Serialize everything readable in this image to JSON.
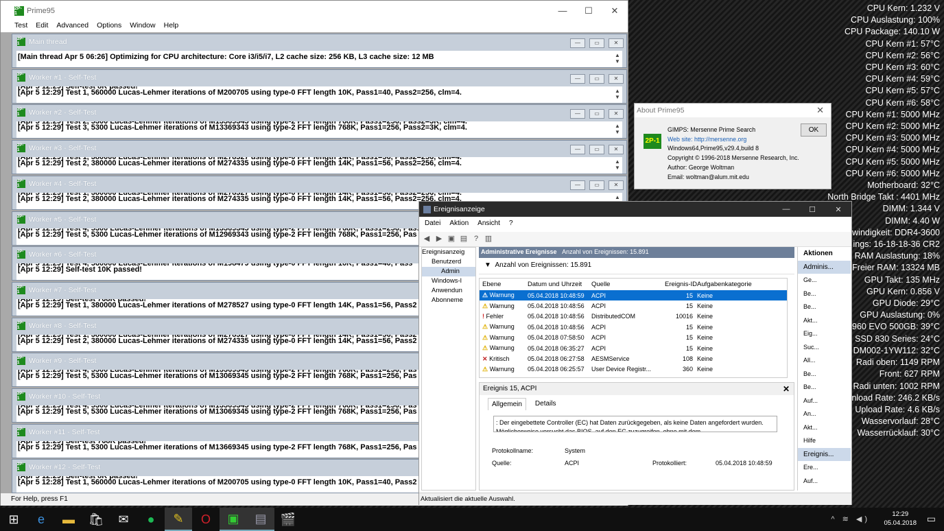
{
  "overlay": [
    "CPU Kern: 1.232 V",
    "CPU Auslastung: 100%",
    "CPU Package: 140.10 W",
    "CPU Kern #1: 57°C",
    "CPU Kern #2: 56°C",
    "CPU Kern #3: 60°C",
    "CPU Kern #4: 59°C",
    "CPU Kern #5: 57°C",
    "CPU Kern #6: 58°C",
    "CPU Kern #1: 5000 MHz",
    "CPU Kern #2: 5000 MHz",
    "CPU Kern #3: 5000 MHz",
    "CPU Kern #4: 5000 MHz",
    "CPU Kern #5: 5000 MHz",
    "CPU Kern #6: 5000 MHz",
    "Motherboard: 32°C",
    "North Bridge Takt : 4401 MHz",
    "DIMM: 1.344 V",
    "DIMM: 4.40 W",
    "windigkeit: DDR4-3600",
    "ings: 16-18-18-36 CR2",
    "RAM Auslastung: 18%",
    "Freier RAM: 13324 MB",
    "GPU Takt: 135 MHz",
    "GPU Kern: 0.856 V",
    "GPU Diode: 29°C",
    "GPU Auslastung: 0%",
    "960 EVO 500GB: 39°C",
    "G SSD 830 Series: 24°C",
    "DM002-1YW112: 32°C",
    "Radi oben: 1149 RPM",
    "Front: 627 RPM",
    "Radi unten: 1002 RPM",
    "nload Rate: 246.2 KB/s",
    "Upload Rate: 4.6 KB/s",
    "Wasservorlauf: 28°C",
    "Wasserrücklauf: 30°C"
  ],
  "prime95": {
    "title": "Prime95",
    "icon_text": "2P-1",
    "menu": [
      "Test",
      "Edit",
      "Advanced",
      "Options",
      "Window",
      "Help"
    ],
    "status": "For Help, press F1",
    "threads": [
      {
        "title": "Main thread",
        "l1": "",
        "l2": "[Main thread Apr 5 06:26] Optimizing for CPU architecture: Core i3/i5/i7, L2 cache size: 256 KB, L3 cache size: 12 MB"
      },
      {
        "title": "Worker #1 - Self-Test",
        "l1": "[Apr 5 12:29] Self-test 8K passed!",
        "l2": "[Apr 5 12:29] Test 1, 560000 Lucas-Lehmer iterations of M200705 using type-0 FFT length 10K, Pass1=40, Pass2=256, clm=4."
      },
      {
        "title": "Worker #2 - Self-Test",
        "l1": "[Apr 5 12:29] Test 2, 5300 Lucas-Lehmer iterations of M13369345 using type-2 FFT length 768K, Pass1=256, Pass2=3K, clm=4.",
        "l2": "[Apr 5 12:29] Test 3, 5300 Lucas-Lehmer iterations of M13369343 using type-2 FFT length 768K, Pass1=256, Pass2=3K, clm=4."
      },
      {
        "title": "Worker #3 - Self-Test",
        "l1": "[Apr 5 12:29] Test 1, 380000 Lucas-Lehmer iterations of M278527 using type-0 FFT length 14K, Pass1=56, Pass2=256, clm=4.",
        "l2": "[Apr 5 12:29] Test 2, 380000 Lucas-Lehmer iterations of M274335 using type-0 FFT length 14K, Pass1=56, Pass2=256, clm=4."
      },
      {
        "title": "Worker #4 - Self-Test",
        "l1": "[Apr 5 12:29] Test 1, 380000 Lucas-Lehmer iterations of M278527 using type-0 FFT length 14K, Pass1=56, Pass2=256, clm=4.",
        "l2": "[Apr 5 12:29] Test 2, 380000 Lucas-Lehmer iterations of M274335 using type-0 FFT length 14K, Pass1=56, Pass2=256, clm=4."
      },
      {
        "title": "Worker #5 - Self-Test",
        "l1": "[Apr 5 12:29] Test 4, 5300 Lucas-Lehmer iterations of M13369345 using type-2 FFT length 768K, Pass1=256, Pass2=3K",
        "l2": "[Apr 5 12:29] Test 5, 5300 Lucas-Lehmer iterations of M12969343 using type-2 FFT length 768K, Pass1=256, Pas"
      },
      {
        "title": "Worker #6 - Self-Test",
        "l1": "[Apr 5 12:29] Test 4, 560000 Lucas-Lehmer iterations of M198479 using type-0 FFT length 10K, Pass1=40, Pass",
        "l2": "[Apr 5 12:29] Self-test 10K passed!"
      },
      {
        "title": "Worker #7 - Self-Test",
        "l1": "[Apr 5 12:29] Self-test 768K passed!",
        "l2": "[Apr 5 12:29] Test 1, 380000 Lucas-Lehmer iterations of M278527 using type-0 FFT length 14K, Pass1=56, Pass2"
      },
      {
        "title": "Worker #8 - Self-Test",
        "l1": "[Apr 5 12:29] Test 1, 380000 Lucas-Lehmer iterations of M278527 using type-0 FFT length 14K, Pass1=56, Pass2",
        "l2": "[Apr 5 12:29] Test 2, 380000 Lucas-Lehmer iterations of M274335 using type-0 FFT length 14K, Pass1=56, Pass2"
      },
      {
        "title": "Worker #9 - Self-Test",
        "l1": "[Apr 5 12:29] Test 4, 5300 Lucas-Lehmer iterations of M13369345 using type-2 FFT length 768K, Pass1=256, Pas",
        "l2": "[Apr 5 12:29] Test 5, 5300 Lucas-Lehmer iterations of M13069345 using type-2 FFT length 768K, Pass1=256, Pas"
      },
      {
        "title": "Worker #10 - Self-Test",
        "l1": "[Apr 5 12:29] Test 4, 5300 Lucas-Lehmer iterations of M13369345 using type-2 FFT length 768K, Pass1=256, Pas",
        "l2": "[Apr 5 12:29] Test 5, 5300 Lucas-Lehmer iterations of M13069345 using type-2 FFT length 768K, Pass1=256, Pas"
      },
      {
        "title": "Worker #11 - Self-Test",
        "l1": "[Apr 5 12:29] Self-test 768K passed!",
        "l2": "[Apr 5 12:29] Test 1, 5300 Lucas-Lehmer iterations of M13669345 using type-2 FFT length 768K, Pass1=256, Pas"
      },
      {
        "title": "Worker #12 - Self-Test",
        "l1": "[Apr 5 12:29] Self-test 8K passed!",
        "l2": "[Apr 5 12:28] Test 1, 560000 Lucas-Lehmer iterations of M200705 using type-0 FFT length 10K, Pass1=40, Pass2"
      }
    ]
  },
  "about": {
    "title": "About Prime95",
    "ok": "OK",
    "lines": [
      "GIMPS: Mersenne Prime Search",
      "Web site: http://mersenne.org",
      "Windows64,Prime95,v29.4,build 8",
      "Copyright © 1996-2018 Mersenne Research, Inc.",
      "Author: George Woltman",
      "Email:  woltman@alum.mit.edu"
    ]
  },
  "eventviewer": {
    "title": "Ereignisanzeige",
    "menu": [
      "Datei",
      "Aktion",
      "Ansicht",
      "?"
    ],
    "tree": [
      "Ereignisanzeig",
      "Benutzerd",
      "Admin",
      "Windows-l",
      "Anwendun",
      "Abonneme"
    ],
    "header": "Administrative Ereignisse",
    "header_count": "Anzahl von Ereignissen: 15.891",
    "filter": "Anzahl von Ereignissen: 15.891",
    "columns": [
      "Ebene",
      "Datum und Uhrzeit",
      "Quelle",
      "Ereignis-ID",
      "Aufgabenkategorie"
    ],
    "rows": [
      [
        "Warnung",
        "05.04.2018 10:48:59",
        "ACPI",
        "15",
        "Keine"
      ],
      [
        "Warnung",
        "05.04.2018 10:48:56",
        "ACPI",
        "15",
        "Keine"
      ],
      [
        "Fehler",
        "05.04.2018 10:48:56",
        "DistributedCOM",
        "10016",
        "Keine"
      ],
      [
        "Warnung",
        "05.04.2018 10:48:56",
        "ACPI",
        "15",
        "Keine"
      ],
      [
        "Warnung",
        "05.04.2018 07:58:50",
        "ACPI",
        "15",
        "Keine"
      ],
      [
        "Warnung",
        "05.04.2018 06:35:27",
        "ACPI",
        "15",
        "Keine"
      ],
      [
        "Kritisch",
        "05.04.2018 06:27:58",
        "AESMService",
        "108",
        "Keine"
      ],
      [
        "Warnung",
        "05.04.2018 06:25:57",
        "User Device Registr...",
        "360",
        "Keine"
      ]
    ],
    "detail_title": "Ereignis 15, ACPI",
    "tabs": [
      "Allgemein",
      "Details"
    ],
    "detail_text": ": Der eingebettete Controller (EC) hat Daten zurückgegeben, als keine Daten angefordert wurden. Möglicherweise versucht das BIOS, auf den EC zuzugreifen, ohne mit dem",
    "protokollname_label": "Protokollname:",
    "protokollname": "System",
    "quelle_label": "Quelle:",
    "quelle": "ACPI",
    "protokolliert_label": "Protokolliert:",
    "protokolliert": "05.04.2018 10:48:59",
    "actions_title": "Aktionen",
    "actions": [
      "Adminis...",
      "Ge...",
      "Be...",
      "Be...",
      "Akt...",
      "Eig...",
      "Suc...",
      "All...",
      "Be...",
      "Be...",
      "Auf...",
      "An...",
      "Akt...",
      "Hilfe",
      "Ereignis...",
      "Ere...",
      "Auf..."
    ],
    "status": "Aktualisiert die aktuelle Auswahl."
  },
  "taskbar": {
    "time": "12:29",
    "date": "05.04.2018"
  }
}
